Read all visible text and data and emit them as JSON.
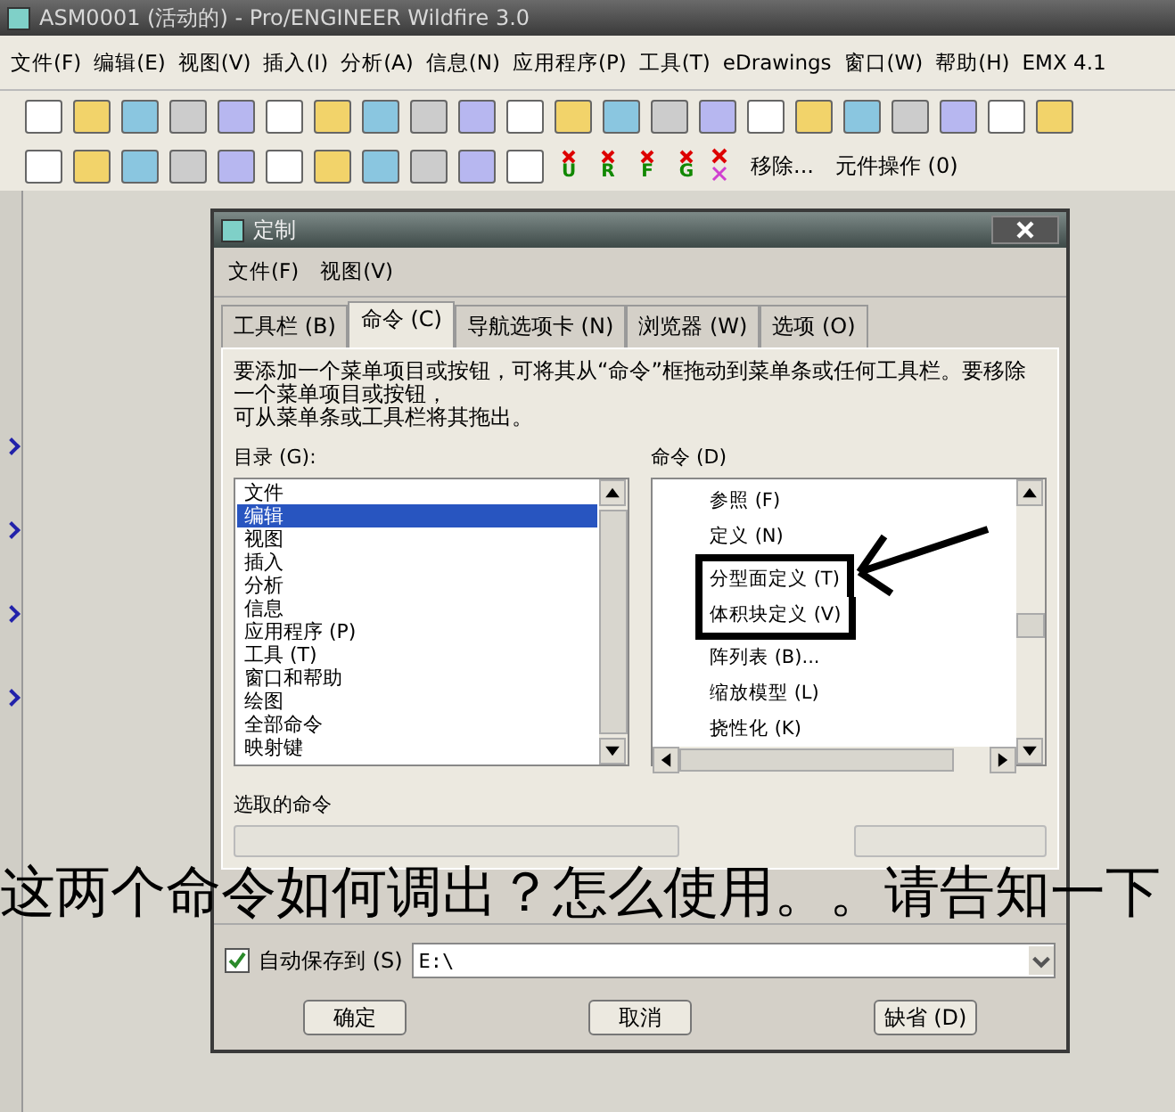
{
  "window": {
    "title": "ASM0001 (活动的) - Pro/ENGINEER Wildfire 3.0"
  },
  "menu_bar": [
    "文件(F)",
    "编辑(E)",
    "视图(V)",
    "插入(I)",
    "分析(A)",
    "信息(N)",
    "应用程序(P)",
    "工具(T)",
    "eDrawings",
    "窗口(W)",
    "帮助(H)",
    "EMX 4.1"
  ],
  "toolbar_2": {
    "marker_labels": [
      "U",
      "R",
      "F",
      "G"
    ],
    "texts": [
      "移除...",
      "元件操作 (0)"
    ]
  },
  "dialog": {
    "title": "定制",
    "menu": [
      "文件(F)",
      "视图(V)"
    ],
    "tabs": [
      {
        "label": "工具栏 (B)",
        "selected": false
      },
      {
        "label": "命令 (C)",
        "selected": true
      },
      {
        "label": "导航选项卡 (N)",
        "selected": false
      },
      {
        "label": "浏览器 (W)",
        "selected": false
      },
      {
        "label": "选项 (O)",
        "selected": false
      }
    ],
    "description": [
      "要添加一个菜单项目或按钮，可将其从“命令”框拖动到菜单条或任何工具栏。要移除一个菜单项目或按钮，",
      "可从菜单条或工具栏将其拖出。"
    ],
    "categories_label": "目录 (G):",
    "categories": [
      {
        "label": "文件",
        "selected": false
      },
      {
        "label": "编辑",
        "selected": true
      },
      {
        "label": "视图",
        "selected": false
      },
      {
        "label": "插入",
        "selected": false
      },
      {
        "label": "分析",
        "selected": false
      },
      {
        "label": "信息",
        "selected": false
      },
      {
        "label": "应用程序 (P)",
        "selected": false
      },
      {
        "label": "工具 (T)",
        "selected": false
      },
      {
        "label": "窗口和帮助",
        "selected": false
      },
      {
        "label": "绘图",
        "selected": false
      },
      {
        "label": "全部命令",
        "selected": false
      },
      {
        "label": "映射键",
        "selected": false
      }
    ],
    "commands_label": "命令 (D)",
    "commands": [
      {
        "label": "参照 (F)",
        "highlighted": false
      },
      {
        "label": "定义 (N)",
        "highlighted": false
      },
      {
        "label": "分型面定义 (T)",
        "highlighted": true
      },
      {
        "label": "体积块定义 (V)",
        "highlighted": true
      },
      {
        "label": "阵列表 (B)...",
        "highlighted": false
      },
      {
        "label": "缩放模型 (L)",
        "highlighted": false
      },
      {
        "label": "挠性化 (K)",
        "highlighted": false
      }
    ],
    "selected_commands_label": "选取的命令",
    "autosave": {
      "label": "自动保存到 (S)",
      "checked": true,
      "value": "E:\\"
    },
    "buttons": [
      "确定",
      "取消",
      "缺省 (D)"
    ]
  },
  "annotation": "这两个命令如何调出？怎么使用。。请告知一下"
}
